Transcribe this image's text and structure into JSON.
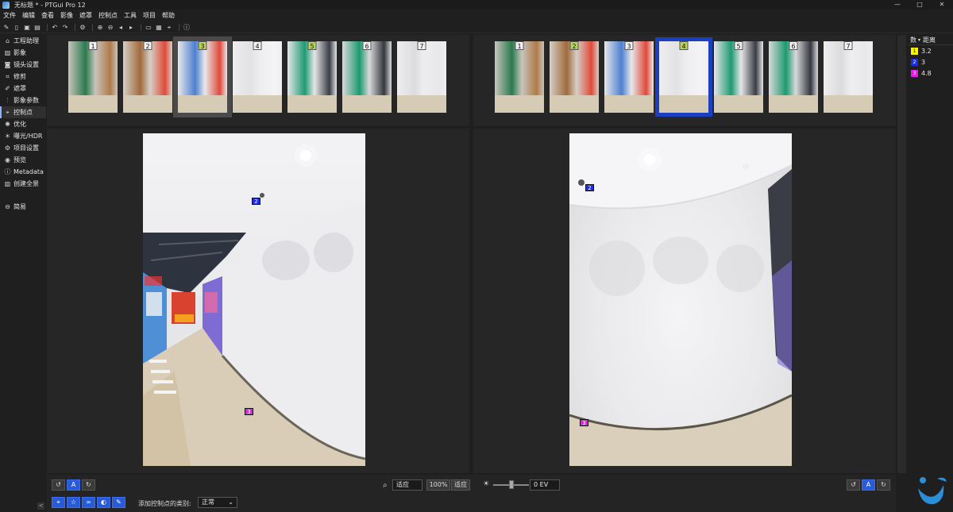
{
  "window": {
    "title": "无标题 * - PTGui Pro 12",
    "controls": [
      "—",
      "□",
      "✕"
    ]
  },
  "menu": [
    "文件",
    "编辑",
    "查看",
    "影像",
    "遮罩",
    "控制点",
    "工具",
    "项目",
    "帮助"
  ],
  "sidebar": {
    "items": [
      {
        "label": "工程助理",
        "icon": "home"
      },
      {
        "label": "影象",
        "icon": "image"
      },
      {
        "label": "镜头设置",
        "icon": "camera"
      },
      {
        "label": "修剪",
        "icon": "crop"
      },
      {
        "label": "遮罩",
        "icon": "mask"
      },
      {
        "label": "影象参数",
        "icon": "sliders"
      },
      {
        "label": "控制点",
        "icon": "pin"
      },
      {
        "label": "优化",
        "icon": "gear"
      },
      {
        "label": "曝光/HDR",
        "icon": "sun"
      },
      {
        "label": "项目设置",
        "icon": "gear"
      },
      {
        "label": "预览",
        "icon": "eye"
      },
      {
        "label": "Metadata",
        "icon": "info"
      },
      {
        "label": "创建全景",
        "icon": "panorama"
      }
    ],
    "simple_label": "简易",
    "collapse": "<"
  },
  "left_strip": {
    "numbers": [
      "1",
      "2",
      "3",
      "4",
      "5",
      "6",
      "7"
    ],
    "selected": "3",
    "highlighted": [
      "3",
      "5"
    ]
  },
  "right_strip": {
    "numbers": [
      "1",
      "2",
      "3",
      "4",
      "5",
      "6",
      "7"
    ],
    "selected": "4",
    "highlighted": [
      "2",
      "4"
    ]
  },
  "left_points": [
    {
      "id": "2"
    },
    {
      "id": "3"
    }
  ],
  "right_points": [
    {
      "id": "2"
    },
    {
      "id": "3"
    }
  ],
  "bottom": {
    "zoom_mode": "适应",
    "zoom_100": "100%",
    "zoom_fit": "适应",
    "ev_value": "0 EV",
    "add_cp_label": "添加控制点的类别:",
    "add_cp_value": "正常",
    "rotate_left": "↺",
    "auto": "A",
    "rotate_right": "↻"
  },
  "cp_table": {
    "headers": [
      "数",
      "距离"
    ],
    "rows": [
      {
        "num": "1",
        "dist": "3.2",
        "color": "#f5f500"
      },
      {
        "num": "2",
        "dist": "3",
        "color": "#1e2fd8"
      },
      {
        "num": "3",
        "dist": "4.8",
        "color": "#e51ce5"
      }
    ]
  }
}
